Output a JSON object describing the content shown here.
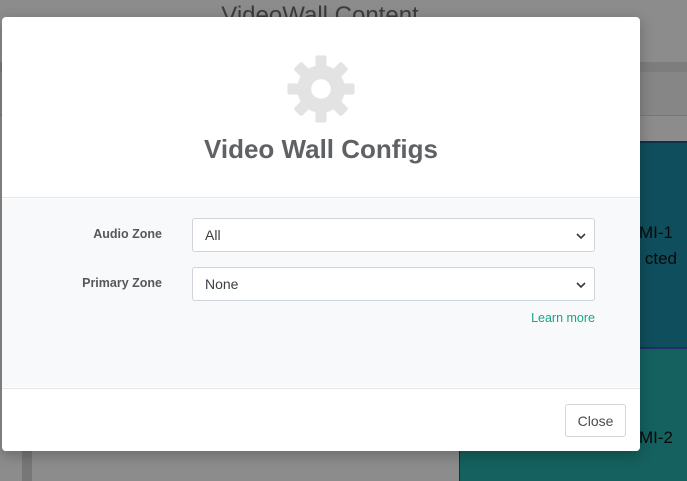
{
  "background": {
    "page_title": "VideoWall Content",
    "tiles": [
      {
        "line1": "MI-1",
        "line2": "cted"
      },
      {
        "line1": "MI-2"
      }
    ]
  },
  "modal": {
    "icon": "gear-icon",
    "title": "Video Wall Configs",
    "fields": [
      {
        "label": "Audio Zone",
        "selected": "All"
      },
      {
        "label": "Primary Zone",
        "selected": "None"
      }
    ],
    "learn_more": "Learn more",
    "close_label": "Close"
  },
  "colors": {
    "accent_link": "#17a589",
    "tile_blue": "#1d8fa8",
    "tile_teal": "#25b1ad"
  }
}
